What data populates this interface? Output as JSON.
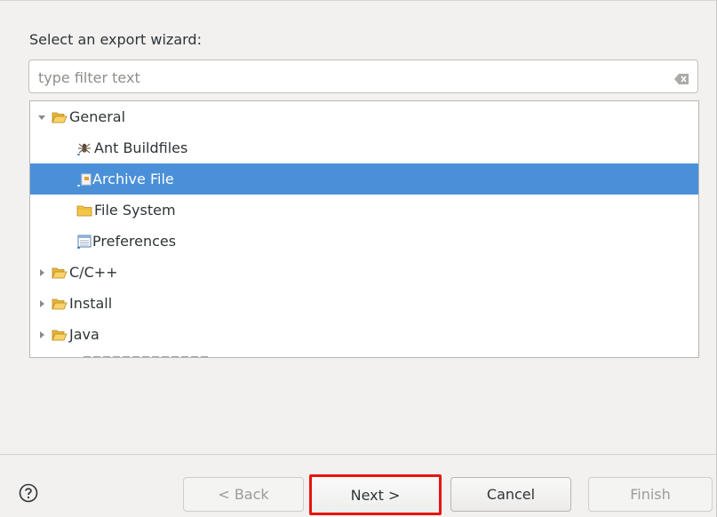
{
  "wizard": {
    "prompt": "Select an export wizard:",
    "filter_placeholder": "type filter text",
    "tree": [
      {
        "label": "General",
        "expanded": true,
        "level": 0,
        "icon": "folder-open-icon"
      },
      {
        "label": "Ant Buildfiles",
        "level": 1,
        "icon": "ant-icon"
      },
      {
        "label": "Archive File",
        "level": 1,
        "icon": "archive-file-icon",
        "selected": true
      },
      {
        "label": "File System",
        "level": 1,
        "icon": "folder-icon"
      },
      {
        "label": "Preferences",
        "level": 1,
        "icon": "preferences-icon"
      },
      {
        "label": "C/C++",
        "expanded": false,
        "level": 0,
        "icon": "folder-open-icon"
      },
      {
        "label": "Install",
        "expanded": false,
        "level": 0,
        "icon": "folder-open-icon"
      },
      {
        "label": "Java",
        "expanded": false,
        "level": 0,
        "icon": "folder-open-icon"
      }
    ]
  },
  "buttons": {
    "back": "< Back",
    "next": "Next >",
    "cancel": "Cancel",
    "finish": "Finish"
  },
  "colors": {
    "selection": "#4a90d9",
    "highlight_border": "#e8140f",
    "folder": "#f5c542"
  }
}
